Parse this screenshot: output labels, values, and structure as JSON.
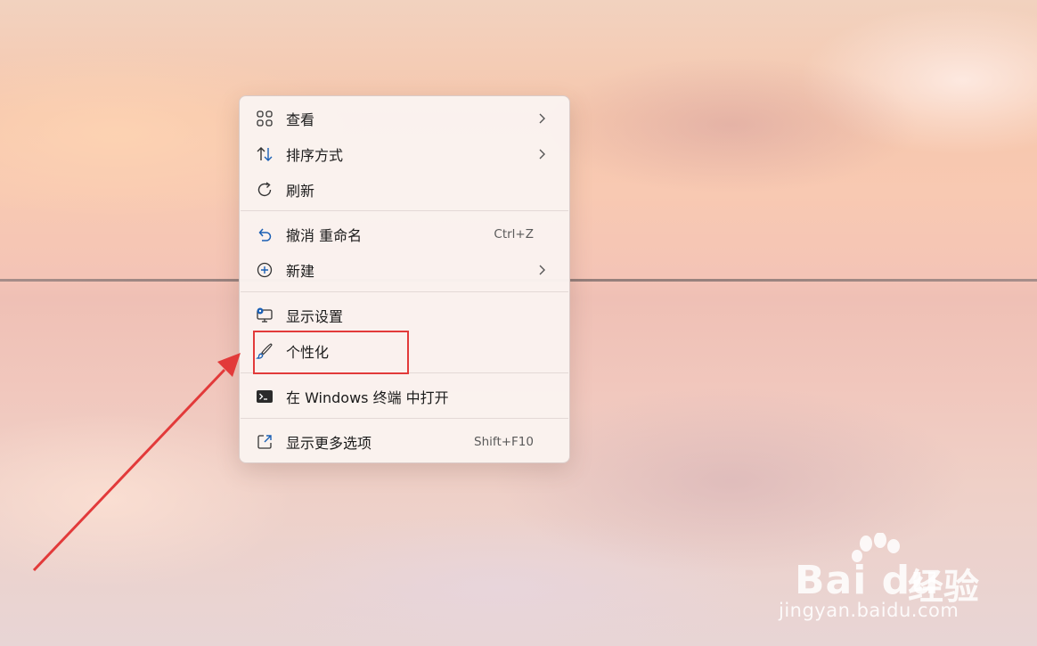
{
  "menu": {
    "items": [
      {
        "label": "查看",
        "icon": "grid-icon",
        "submenu": true
      },
      {
        "label": "排序方式",
        "icon": "sort-arrows-icon",
        "submenu": true
      },
      {
        "label": "刷新",
        "icon": "refresh-icon"
      },
      {
        "label": "撤消 重命名",
        "icon": "undo-icon",
        "shortcut": "Ctrl+Z"
      },
      {
        "label": "新建",
        "icon": "add-circle-icon",
        "submenu": true
      },
      {
        "label": "显示设置",
        "icon": "monitor-settings-icon"
      },
      {
        "label": "个性化",
        "icon": "paint-brush-icon"
      },
      {
        "label": "在 Windows 终端 中打开",
        "icon": "terminal-icon"
      },
      {
        "label": "显示更多选项",
        "icon": "open-external-icon",
        "shortcut": "Shift+F10"
      }
    ]
  },
  "annotation": {
    "highlight_color": "#e23a3a",
    "highlighted_item": "个性化"
  },
  "watermark": {
    "brand_latin": "Bai du",
    "brand_cn": "经验",
    "url": "jingyan.baidu.com"
  },
  "colors": {
    "icon_blue": "#1a5fb4",
    "text": "#1b1b1b",
    "shortcut_text": "#5a5a5a"
  }
}
